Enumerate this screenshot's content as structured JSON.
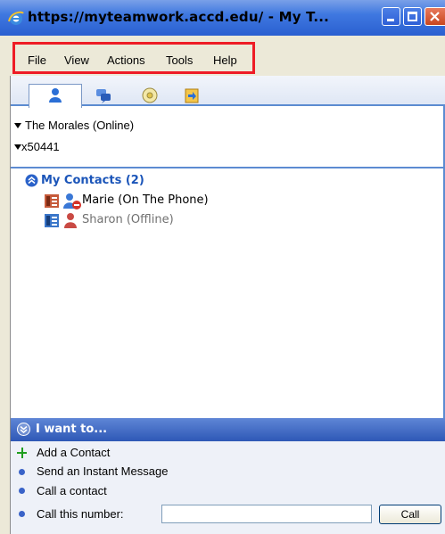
{
  "window": {
    "title": "https://myteamwork.accd.edu/ - My T...",
    "accent": "#3f78e0"
  },
  "menu": {
    "items": [
      "File",
      "View",
      "Actions",
      "Tools",
      "Help"
    ],
    "highlight_color": "#ee1c25"
  },
  "tabs": [
    {
      "name": "contacts",
      "icon": "person-icon",
      "active": true
    },
    {
      "name": "conversations",
      "icon": "chat-bubbles-icon",
      "active": false
    },
    {
      "name": "media",
      "icon": "disc-icon",
      "active": false
    },
    {
      "name": "history",
      "icon": "history-icon",
      "active": false
    }
  ],
  "status": {
    "user": "The Morales (Online)",
    "phone": "x50441"
  },
  "group": {
    "title": "My Contacts (2)",
    "contacts": [
      {
        "name": "Marie (On The Phone)",
        "state": "on-the-phone"
      },
      {
        "name": "Sharon (Offline)",
        "state": "offline"
      }
    ]
  },
  "iwant": {
    "title": "I want to...",
    "actions": [
      "Add a Contact",
      "Send an Instant Message",
      "Call a contact",
      "Call this number:"
    ],
    "call_input_value": "",
    "call_button": "Call"
  }
}
